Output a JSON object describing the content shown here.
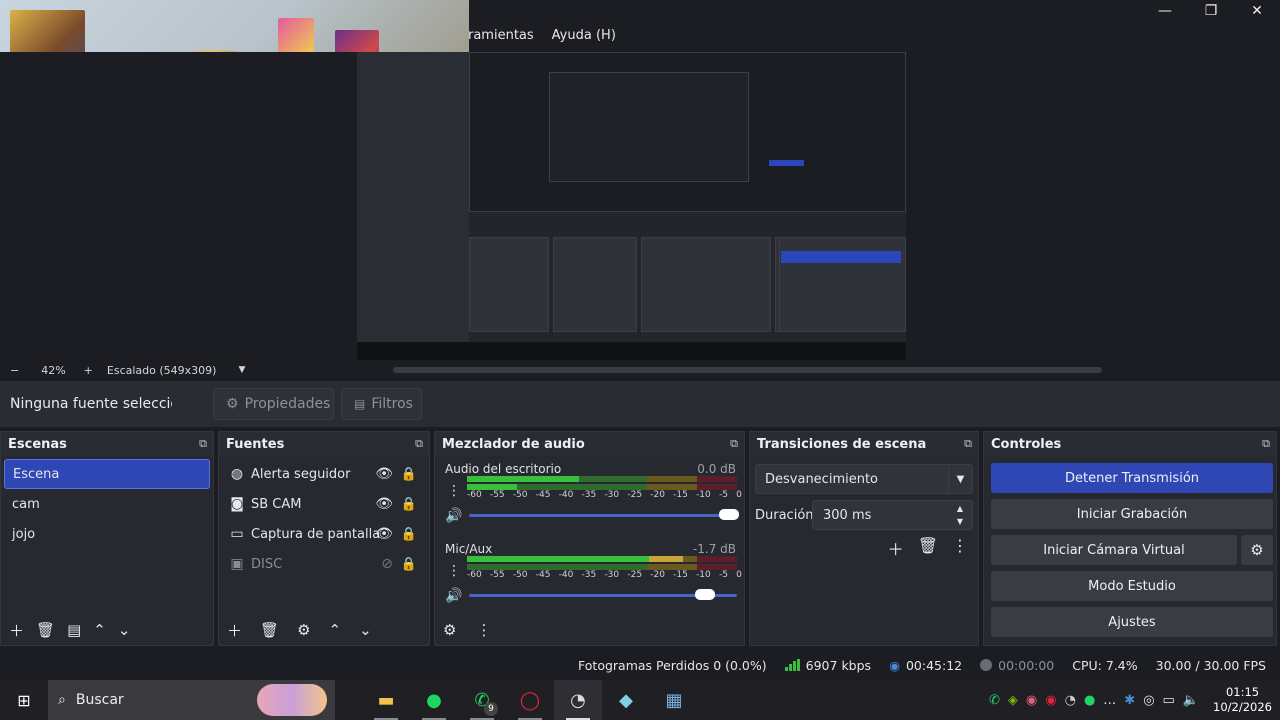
{
  "menu": {
    "items": [
      "ramientas",
      "Ayuda (H)"
    ]
  },
  "window_controls": {
    "minimize": "—",
    "maximize": "❐",
    "close": "✕"
  },
  "zoom": {
    "minus": "−",
    "level": "42%",
    "plus": "+",
    "scaling": "Escalado (549x309)",
    "dropdown": "▼"
  },
  "source_bar": {
    "no_source": "Ninguna fuente seleccionada",
    "properties": "Propiedades",
    "filters": "Filtros"
  },
  "scenes": {
    "title": "Escenas",
    "items": [
      "Escena",
      "cam",
      "jojo"
    ]
  },
  "sources": {
    "title": "Fuentes",
    "items": [
      {
        "name": "Alerta seguidor",
        "icon": "globe-icon"
      },
      {
        "name": "SB CAM",
        "icon": "camera-icon"
      },
      {
        "name": "Captura de pantalla",
        "icon": "monitor-icon"
      },
      {
        "name": "DISC",
        "icon": "window-icon"
      }
    ]
  },
  "mixer": {
    "title": "Mezclador de audio",
    "channels": [
      {
        "name": "Audio del escritorio",
        "db": "0.0 dB",
        "volume": 0.97
      },
      {
        "name": "Mic/Aux",
        "db": "-1.7 dB",
        "volume": 0.88
      }
    ],
    "scale": [
      "-60",
      "-55",
      "-50",
      "-45",
      "-40",
      "-35",
      "-30",
      "-25",
      "-20",
      "-15",
      "-10",
      "-5",
      "0"
    ]
  },
  "transitions": {
    "title": "Transiciones de escena",
    "selected": "Desvanecimiento",
    "duration_label": "Duración",
    "duration_value": "300 ms"
  },
  "controls": {
    "title": "Controles",
    "stop_stream": "Detener Transmisión",
    "start_recording": "Iniciar Grabación",
    "start_virtual_cam": "Iniciar Cámara Virtual",
    "studio_mode": "Modo Estudio",
    "settings": "Ajustes"
  },
  "status": {
    "dropped_frames": "Fotogramas Perdidos 0 (0.0%)",
    "bitrate": "6907 kbps",
    "stream_time": "00:45:12",
    "rec_time": "00:00:00",
    "cpu": "CPU: 7.4%",
    "fps": "30.00 / 30.00 FPS"
  },
  "taskbar": {
    "search_placeholder": "Buscar",
    "whatsapp_badge": "9",
    "time": "01:15",
    "date": "10/2/2026"
  },
  "colors": {
    "accent": "#2e47b5",
    "meter_green": "#38c03c",
    "meter_yellow": "#c8a53a",
    "meter_red": "#b02a3a"
  }
}
